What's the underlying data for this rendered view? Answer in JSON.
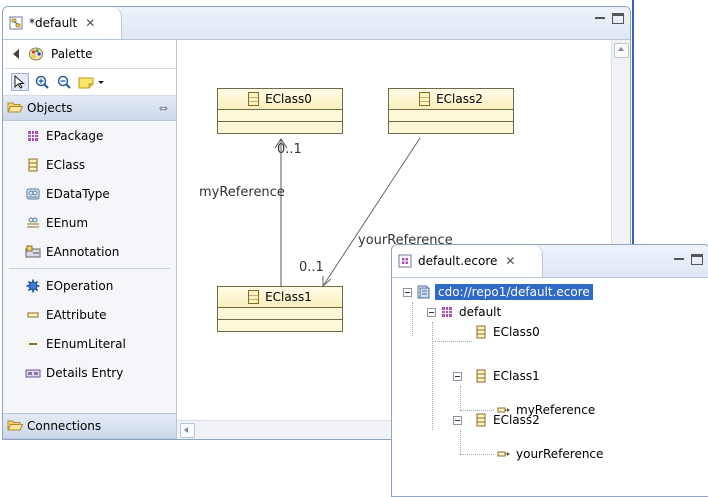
{
  "editor": {
    "tab_title": "*default",
    "tab_close": "✕"
  },
  "palette": {
    "title": "Palette",
    "objects_drawer": "Objects",
    "drawer_pin": "⇔",
    "items": [
      {
        "label": "EPackage",
        "icon": "epackage-icon"
      },
      {
        "label": "EClass",
        "icon": "eclass-icon"
      },
      {
        "label": "EDataType",
        "icon": "edatatype-icon"
      },
      {
        "label": "EEnum",
        "icon": "eenum-icon"
      },
      {
        "label": "EAnnotation",
        "icon": "eannotation-icon"
      },
      {
        "label": "EOperation",
        "icon": "eoperation-icon"
      },
      {
        "label": "EAttribute",
        "icon": "eattribute-icon"
      },
      {
        "label": "EEnumLiteral",
        "icon": "eenumliteral-icon"
      },
      {
        "label": "Details Entry",
        "icon": "details-entry-icon"
      }
    ],
    "connections_drawer": "Connections"
  },
  "diagram": {
    "classes": [
      "EClass0",
      "EClass2",
      "EClass1"
    ],
    "labels": {
      "myReference": "myReference",
      "yourReference": "yourReference",
      "mult_top": "0..1",
      "mult_bottom": "0..1"
    }
  },
  "tree": {
    "tab_title": "default.ecore",
    "tab_close": "✕",
    "root": "cdo://repo1/default.ecore",
    "package": "default",
    "class0": "EClass0",
    "class1": "EClass1",
    "ref1": "myReference",
    "class2": "EClass2",
    "ref2": "yourReference"
  },
  "colors": {
    "selection": "#3169c6",
    "class_fill": "#fdf9d8"
  }
}
